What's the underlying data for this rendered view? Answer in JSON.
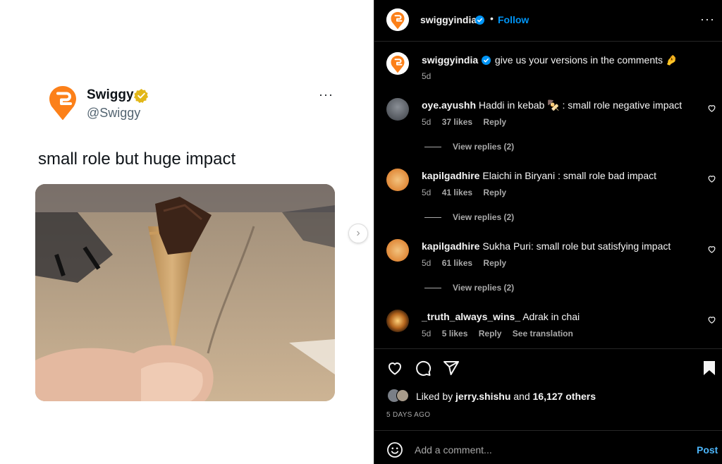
{
  "tweet": {
    "name": "Swiggy",
    "handle": "@Swiggy",
    "more": "···",
    "text": "small role but huge impact"
  },
  "header": {
    "username": "swiggyindia",
    "separator": "•",
    "follow_label": "Follow",
    "more": "···"
  },
  "caption": {
    "username": "swiggyindia",
    "text": "give us your versions in the comments 🤌",
    "time": "5d"
  },
  "comments": [
    {
      "username": "oye.ayushh",
      "text": "Haddi in kebab 🍢 : small role negative impact",
      "time": "5d",
      "likes": "37 likes",
      "reply": "Reply",
      "view_replies": "View replies (2)"
    },
    {
      "username": "kapilgadhire",
      "text": "Elaichi in Biryani : small role bad impact",
      "time": "5d",
      "likes": "41 likes",
      "reply": "Reply",
      "view_replies": "View replies (2)"
    },
    {
      "username": "kapilgadhire",
      "text": "Sukha Puri: small role but satisfying impact",
      "time": "5d",
      "likes": "61 likes",
      "reply": "Reply",
      "view_replies": "View replies (2)"
    },
    {
      "username": "_truth_always_wins_",
      "text": "Adrak in chai",
      "time": "5d",
      "likes": "5 likes",
      "reply": "Reply",
      "translation": "See translation"
    }
  ],
  "likes": {
    "prefix": "Liked by",
    "user": "jerry.shishu",
    "middle": "and",
    "others": "16,127 others"
  },
  "posted_ago": "5 DAYS AGO",
  "add_comment": {
    "placeholder": "Add a comment...",
    "post_label": "Post"
  },
  "colors": {
    "swiggy_orange": "#fc8019",
    "follow_blue": "#0095f6",
    "post_blue": "#4cb5f9",
    "verified_blue": "#0095f6",
    "verified_gold": "#e2b719"
  },
  "icons": [
    "swiggy-logo",
    "verified-badge",
    "heart-icon",
    "comment-icon",
    "share-icon",
    "bookmark-icon",
    "emoji-icon",
    "chevron-right-icon"
  ]
}
